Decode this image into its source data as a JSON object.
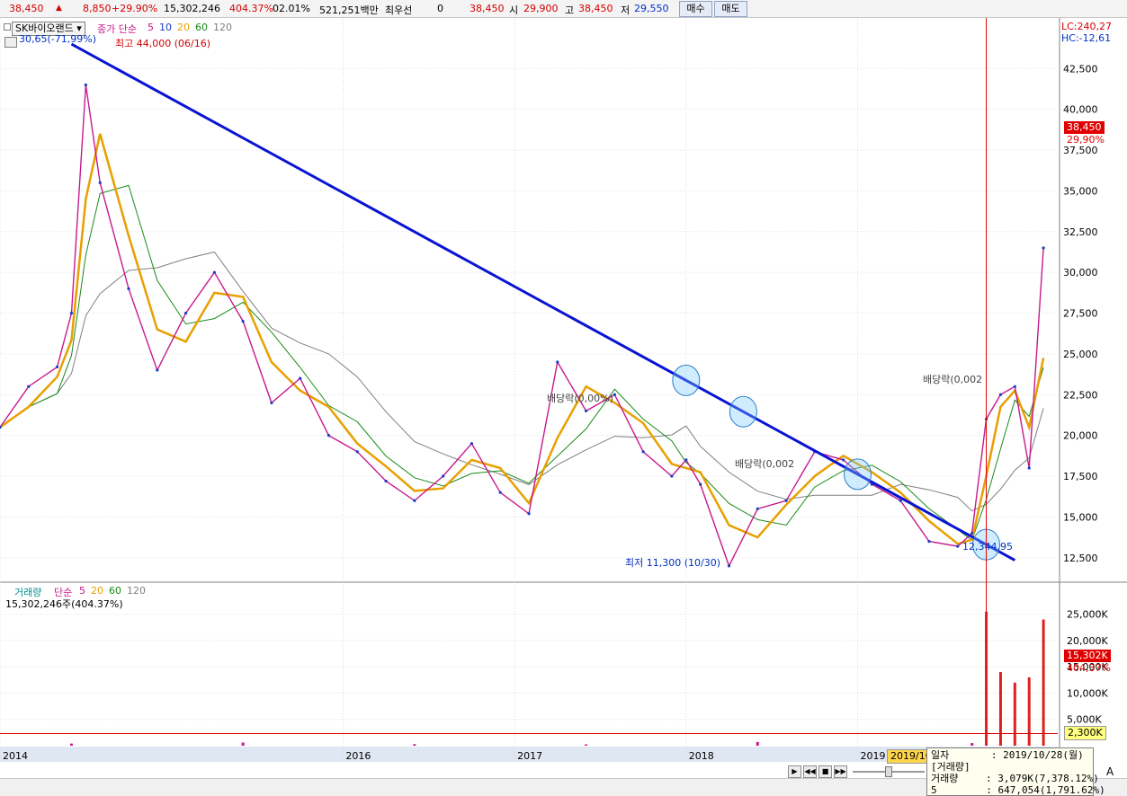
{
  "topbar": {
    "price": "38,450",
    "change": "8,850",
    "change_pct": "+29.90%",
    "volume": "15,302,246",
    "volume_ratio": "404.37%",
    "turnover_ratio": "02.01%",
    "amount": "521,251백만",
    "best_bid_label": "최우선",
    "best_bid_qty": "0",
    "best_price": "38,450",
    "open_label": "시",
    "open": "29,900",
    "high_label": "고",
    "high": "38,450",
    "low_label": "저",
    "low": "29,550",
    "buy_button": "매수",
    "sell_button": "매도"
  },
  "price_legend": {
    "stock_name": "SK바이오랜드",
    "ma_label": "종가 단순",
    "periods": [
      "5",
      "10",
      "20",
      "60",
      "120"
    ],
    "period_colors": [
      "#c81a8c",
      "#1c3cc8",
      "#e8a000",
      "#1a8a1a",
      "#808080"
    ]
  },
  "volume_legend": {
    "label": "거래량",
    "ma_label": "단순",
    "periods": [
      "5",
      "20",
      "60",
      "120"
    ],
    "period_colors": [
      "#c81a8c",
      "#e8a000",
      "#1a8a1a",
      "#808080"
    ],
    "current": "15,302,246주(404.37%)"
  },
  "annotations": {
    "high_ratio": "30,65(-71,99%)",
    "high": "최고 44,000 (06/16)",
    "low": "최저 11,300 (10/30)",
    "trend_end": "12,344,95",
    "dividend": "배당락(0,00%)",
    "dividend_2": "배당락(0,002",
    "dividend_3": "배당락(0,002",
    "lc": "LC:240,27",
    "hc": "HC:-12,61",
    "last_price": "38,450",
    "last_pct": "29,90%",
    "last_volume": "15,302K",
    "last_volume_pct": "404,37%",
    "volume_ma_value": "2,300K"
  },
  "tooltip": {
    "date_label": "일자",
    "date_value": ": 2019/10/28(월)",
    "section": "[거래량]",
    "row1_label": "거래량",
    "row1_value": ": 3,079K(7,378.12%)",
    "row2_label": "5",
    "row2_value": ": 647,054(1,791.62%)"
  },
  "cursor_date": "2019/10",
  "chart_data": [
    {
      "type": "line",
      "name": "price",
      "x": [
        "2014-01",
        "2014-03",
        "2014-05",
        "2014-06",
        "2014-07",
        "2014-08",
        "2014-10",
        "2014-12",
        "2015-02",
        "2015-04",
        "2015-06",
        "2015-08",
        "2015-10",
        "2015-12",
        "2016-02",
        "2016-04",
        "2016-06",
        "2016-08",
        "2016-10",
        "2016-12",
        "2017-02",
        "2017-04",
        "2017-06",
        "2017-08",
        "2017-10",
        "2017-12",
        "2018-01",
        "2018-02",
        "2018-04",
        "2018-06",
        "2018-08",
        "2018-10",
        "2018-12",
        "2019-02",
        "2019-04",
        "2019-06",
        "2019-08",
        "2019-09",
        "2019-10",
        "2019-11",
        "2019-12",
        "2020-01",
        "2020-02"
      ],
      "y": [
        20500,
        23000,
        24200,
        27500,
        41500,
        35500,
        29000,
        24000,
        27500,
        30000,
        27000,
        22000,
        23500,
        20000,
        19000,
        17200,
        16000,
        17500,
        19500,
        16500,
        15200,
        24500,
        21500,
        22500,
        19000,
        17500,
        18500,
        17000,
        12000,
        15500,
        16000,
        19000,
        18500,
        17000,
        16000,
        13500,
        13200,
        14000,
        21000,
        22500,
        23000,
        18000,
        31500
      ],
      "ylim": [
        11000,
        44500
      ],
      "yticks": [
        12500,
        15000,
        17500,
        20000,
        22500,
        25000,
        27500,
        30000,
        32500,
        35000,
        37500,
        40000,
        42500
      ],
      "ytick_labels": [
        "12,500",
        "15,000",
        "17,500",
        "20,000",
        "22,500",
        "25,000",
        "27,500",
        "30,000",
        "32,500",
        "35,000",
        "37,500",
        "40,000",
        "42,500"
      ],
      "xlabels": [
        "2014",
        "2016",
        "2017",
        "2018",
        "2019"
      ]
    },
    {
      "type": "line",
      "name": "trendline",
      "x": [
        "2014-06",
        "2019-12"
      ],
      "y": [
        44000,
        12345
      ]
    },
    {
      "type": "bar",
      "name": "volume",
      "categories": [
        "2014",
        "2015",
        "2016",
        "2017",
        "2018",
        "2019-09",
        "2019-10",
        "2019-11",
        "2019-12",
        "2020-01",
        "2020-02"
      ],
      "values": [
        400,
        600,
        300,
        250,
        700,
        500,
        25500,
        14000,
        12000,
        13000,
        24000
      ],
      "ylim": [
        0,
        27000
      ],
      "yticks": [
        5000,
        10000,
        15000,
        20000,
        25000
      ],
      "ytick_labels": [
        "5,000K",
        "10,000K",
        "15,000K",
        "20,000K",
        "25,000K"
      ]
    }
  ]
}
